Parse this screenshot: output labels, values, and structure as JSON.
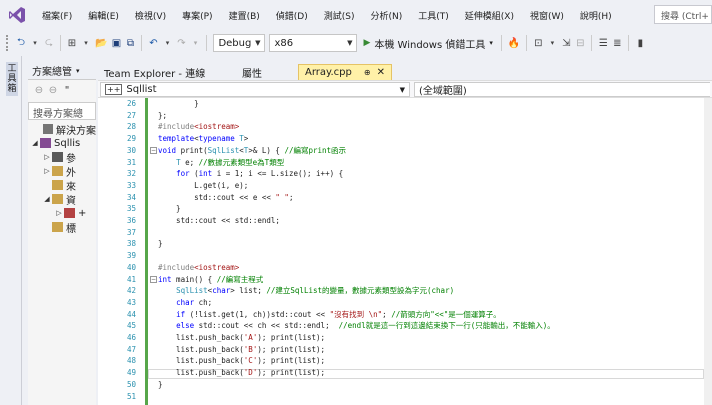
{
  "menu": [
    "檔案(F)",
    "編輯(E)",
    "檢視(V)",
    "專案(P)",
    "建置(B)",
    "偵錯(D)",
    "測試(S)",
    "分析(N)",
    "工具(T)",
    "延伸模組(X)",
    "視窗(W)",
    "說明(H)"
  ],
  "search_placeholder": "搜尋 (Ctrl+",
  "toolbar": {
    "config": "Debug",
    "platform": "x86",
    "run_label": "本機 Windows 偵錯工具"
  },
  "left_strip": {
    "toolbox_tab": "工具箱"
  },
  "solution_panel": {
    "title": "方案總管",
    "search_placeholder": "搜尋方案總",
    "tree": [
      "解決方案",
      "Sqllis",
      "參",
      "外",
      "來",
      "資",
      "+",
      "標"
    ]
  },
  "editor": {
    "tabs": [
      {
        "label": "Team Explorer - 連線",
        "active": false
      },
      {
        "label": "屬性",
        "active": false
      },
      {
        "label": "Array.cpp",
        "active": true,
        "pin": "⊕",
        "close": "✕"
      }
    ],
    "nav_left": "Sqllist",
    "nav_right": "(全域範圍)",
    "line_numbers": [
      "26",
      "27",
      "28",
      "29",
      "30",
      "31",
      "32",
      "33",
      "34",
      "35",
      "36",
      "37",
      "38",
      "39",
      "40",
      "41",
      "42",
      "43",
      "44",
      "45",
      "46",
      "47",
      "48",
      "49",
      "50",
      "51"
    ],
    "code": [
      "        }",
      "};",
      "#include<iostream>",
      "template<typename T>",
      "void print(SqlList<T>& L) { //編寫print函示",
      "    T e; //數據元素類型e為T類型",
      "    for (int i = 1; i <= L.size(); i++) {",
      "        L.get(i, e);",
      "        std::cout << e << \" \";",
      "    }",
      "    std::cout << std::endl;",
      "",
      "}",
      "",
      "#include<iostream>",
      "int main() { //編寫主程式",
      "    SqlList<char> list; //建立SqlList的變量，數據元素類型設為字元(char)",
      "    char ch;",
      "    if (!list.get(1, ch))std::cout << \"沒有找到 \\n\"; //箭頭方向\"<<\"是一個運算子。",
      "    else std::cout << ch << std::endl;  //endl就是這一行到這邊結束換下一行(只能輸出，不能輸入)。",
      "    list.push_back('A'); print(list);",
      "    list.push_back('B'); print(list);",
      "    list.push_back('C'); print(list);",
      "    list.push_back('D'); print(list);",
      "}",
      ""
    ]
  }
}
